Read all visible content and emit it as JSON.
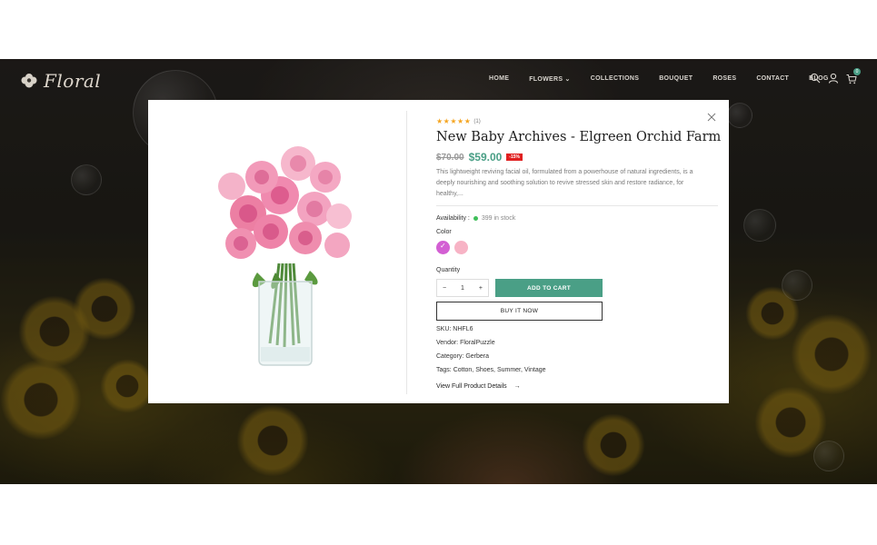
{
  "nav": {
    "logo_text": "Floral",
    "menu": [
      "HOME",
      "FLOWERS",
      "COLLECTIONS",
      "BOUQUET",
      "ROSES",
      "CONTACT",
      "BLOG"
    ],
    "cart_count": "0"
  },
  "modal": {
    "rating_stars": "★★★★★",
    "rating_count": "(1)",
    "title": "New Baby Archives - Elgreen Orchid Farm",
    "old_price": "$70.00",
    "new_price": "$59.00",
    "discount": "-15%",
    "description": "This lightweight reviving facial oil, formulated from a powerhouse of natural ingredients, is a deeply nourishing and soothing solution to revive stressed skin and restore radiance, for healthy,...",
    "availability_label": "Availability :",
    "availability_value": "399 in stock",
    "color_label": "Color",
    "colors": [
      "#d35fd3",
      "#f7b3c5"
    ],
    "quantity_label": "Quantity",
    "quantity_value": "1",
    "qty_minus": "−",
    "qty_plus": "+",
    "add_to_cart": "ADD TO CART",
    "buy_now": "BUY IT NOW",
    "sku_label": "SKU:",
    "sku_value": "NHFL6",
    "vendor_label": "Vendor:",
    "vendor_value": "FloralPuzzle",
    "category_label": "Category:",
    "category_value": "Gerbera",
    "tags_label": "Tags:",
    "tags_value": "Cotton, Shoes, Summer, Vintage",
    "details_link": "View Full Product Details",
    "details_arrow": "→",
    "close_icon": "close-icon"
  }
}
